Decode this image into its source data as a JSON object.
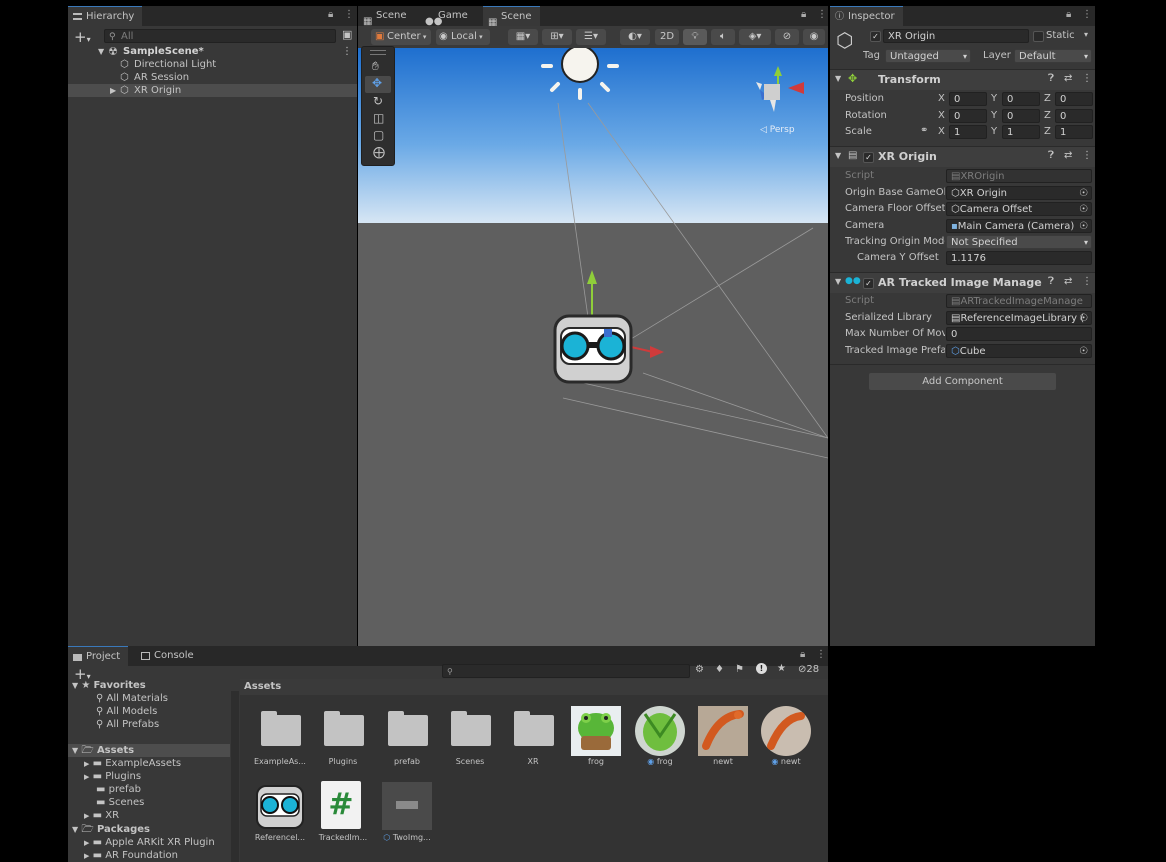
{
  "hierarchy": {
    "tab_label": "Hierarchy",
    "search_placeholder": "All",
    "scene_name": "SampleScene*",
    "items": [
      "Directional Light",
      "AR Session",
      "XR Origin"
    ]
  },
  "scene_view": {
    "tabs": [
      "Scene",
      "Game",
      "Scene"
    ],
    "pivot_label": "Center",
    "space_label": "Local",
    "mode_2d_label": "2D",
    "persp_label": "◁ Persp"
  },
  "inspector": {
    "tab_label": "Inspector",
    "object_name": "XR Origin",
    "static_label": "Static",
    "tag_label": "Tag",
    "tag_value": "Untagged",
    "layer_label": "Layer",
    "layer_value": "Default",
    "transform": {
      "title": "Transform",
      "position_label": "Position",
      "rotation_label": "Rotation",
      "scale_label": "Scale",
      "axis_x": "X",
      "axis_y": "Y",
      "axis_z": "Z",
      "position": [
        "0",
        "0",
        "0"
      ],
      "rotation": [
        "0",
        "0",
        "0"
      ],
      "scale": [
        "1",
        "1",
        "1"
      ]
    },
    "xr_origin": {
      "title": "XR Origin",
      "script_label": "Script",
      "script_value": "XROrigin",
      "origin_base_label": "Origin Base GameOb",
      "origin_base_value": "XR Origin",
      "camera_floor_label": "Camera Floor Offset",
      "camera_floor_value": "Camera Offset",
      "camera_label": "Camera",
      "camera_value": "Main Camera (Camera)",
      "tracking_mode_label": "Tracking Origin Mode",
      "tracking_mode_value": "Not Specified",
      "camera_y_label": "Camera Y Offset",
      "camera_y_value": "1.1176"
    },
    "ar_tracked": {
      "title": "AR Tracked Image Manager (Sc",
      "script_label": "Script",
      "script_value": "ARTrackedImageManage",
      "library_label": "Serialized Library",
      "library_value": "ReferenceImageLibrary (",
      "max_label": "Max Number Of Movi",
      "max_value": "0",
      "prefab_label": "Tracked Image Prefa",
      "prefab_value": "Cube"
    },
    "add_component": "Add Component"
  },
  "project": {
    "tabs": [
      "Project",
      "Console"
    ],
    "hidden_count": "28",
    "favorites_label": "Favorites",
    "favorites": [
      "All Materials",
      "All Models",
      "All Prefabs"
    ],
    "assets_label": "Assets",
    "asset_folders": [
      "ExampleAssets",
      "Plugins",
      "prefab",
      "Scenes",
      "XR"
    ],
    "packages_label": "Packages",
    "packages": [
      "Apple ARKit XR Plugin",
      "AR Foundation"
    ],
    "breadcrumb": "Assets",
    "grid_row1": [
      "ExampleAs...",
      "Plugins",
      "prefab",
      "Scenes",
      "XR",
      "frog",
      "frog",
      "newt",
      "newt"
    ],
    "grid_row2": [
      "Referencel...",
      "TrackedIm...",
      "TwoImg..."
    ]
  },
  "colors": {
    "panel": "#383838",
    "tabbar": "#282828",
    "field": "#2a2a2a",
    "accent": "#3a79bb",
    "sky_top": "#1e6fcf",
    "ground": "#5f5f5f"
  }
}
